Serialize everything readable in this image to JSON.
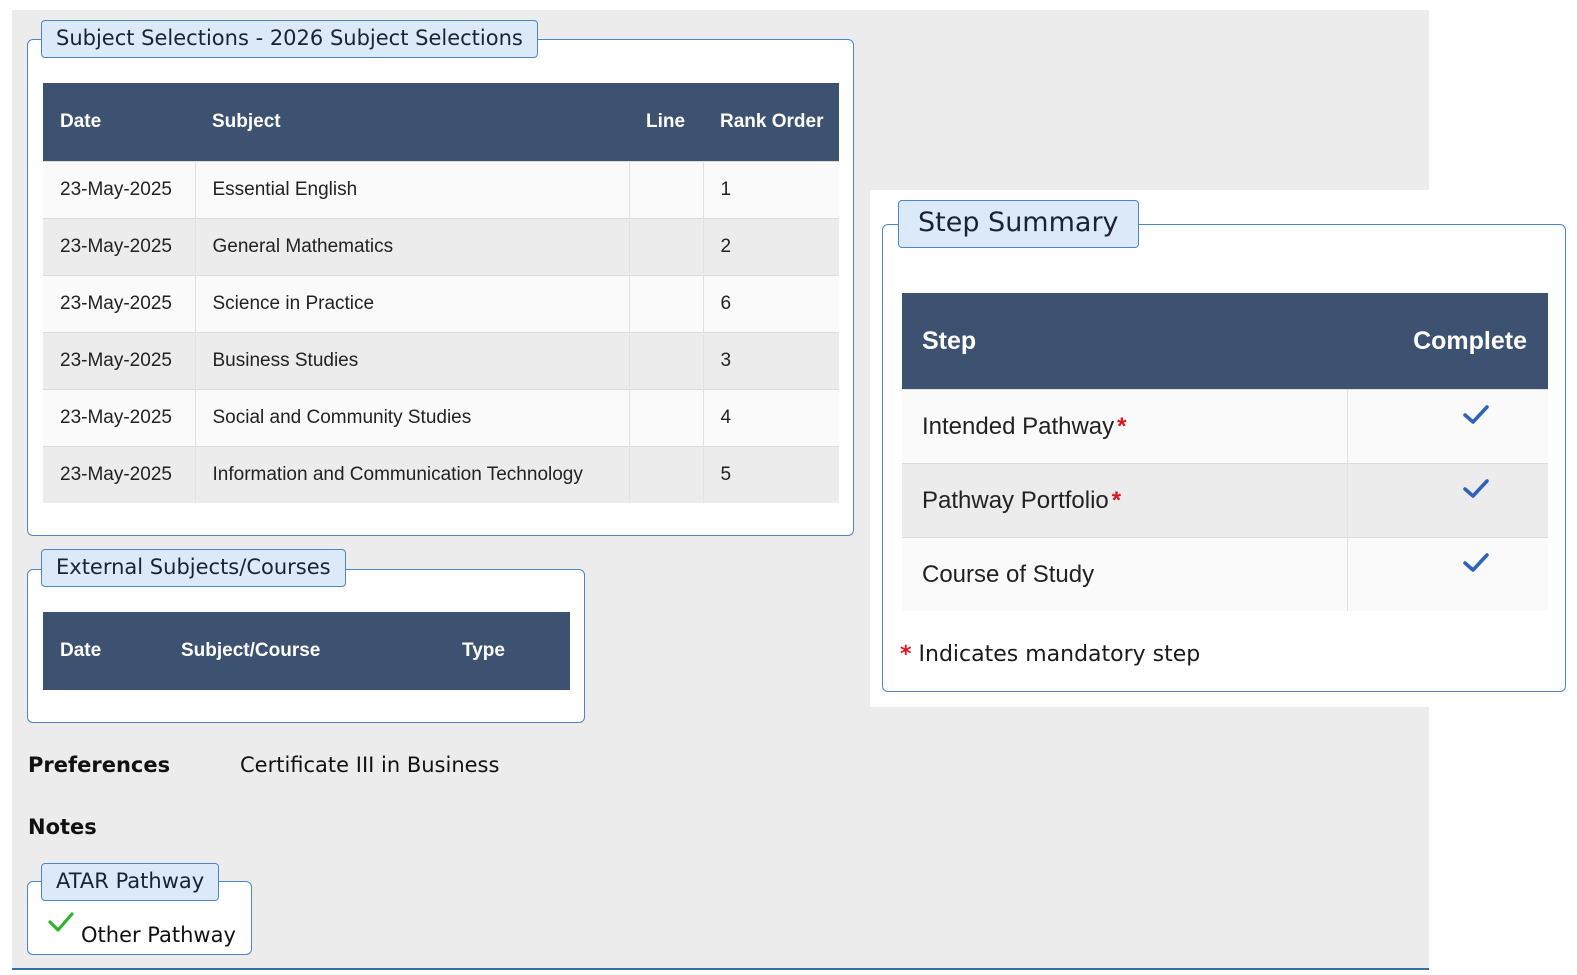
{
  "subject_selections": {
    "title": "Subject Selections - 2026 Subject Selections",
    "columns": {
      "date": "Date",
      "subject": "Subject",
      "line": "Line",
      "rank": "Rank Order"
    },
    "rows": [
      {
        "date": "23-May-2025",
        "subject": "Essential English",
        "line": "",
        "rank": "1"
      },
      {
        "date": "23-May-2025",
        "subject": "General Mathematics",
        "line": "",
        "rank": "2"
      },
      {
        "date": "23-May-2025",
        "subject": "Science in Practice",
        "line": "",
        "rank": "6"
      },
      {
        "date": "23-May-2025",
        "subject": "Business Studies",
        "line": "",
        "rank": "3"
      },
      {
        "date": "23-May-2025",
        "subject": "Social and Community Studies",
        "line": "",
        "rank": "4"
      },
      {
        "date": "23-May-2025",
        "subject": "Information and Communication Technology",
        "line": "",
        "rank": "5"
      }
    ]
  },
  "external": {
    "title": "External Subjects/Courses",
    "columns": {
      "date": "Date",
      "course": "Subject/Course",
      "type": "Type"
    }
  },
  "preferences": {
    "label": "Preferences",
    "value": "Certificate III in Business"
  },
  "notes": {
    "label": "Notes"
  },
  "pathway": {
    "title": "ATAR Pathway",
    "option": "Other Pathway",
    "option_checked": true
  },
  "step_summary": {
    "title": "Step Summary",
    "columns": {
      "step": "Step",
      "complete": "Complete"
    },
    "rows": [
      {
        "step": "Intended Pathway",
        "mandatory": true,
        "complete": true
      },
      {
        "step": "Pathway Portfolio",
        "mandatory": true,
        "complete": true
      },
      {
        "step": "Course of Study",
        "mandatory": false,
        "complete": true
      }
    ],
    "star": "*",
    "note": "Indicates mandatory step"
  },
  "colors": {
    "header_bg": "#3d5270",
    "accent": "#4a86c8",
    "check": "#2f63b8",
    "check_green": "#2db52d",
    "mandatory": "#e0141e"
  },
  "icons": {
    "complete": "checkmark-icon",
    "pathway_selected": "green-checkmark-icon"
  }
}
